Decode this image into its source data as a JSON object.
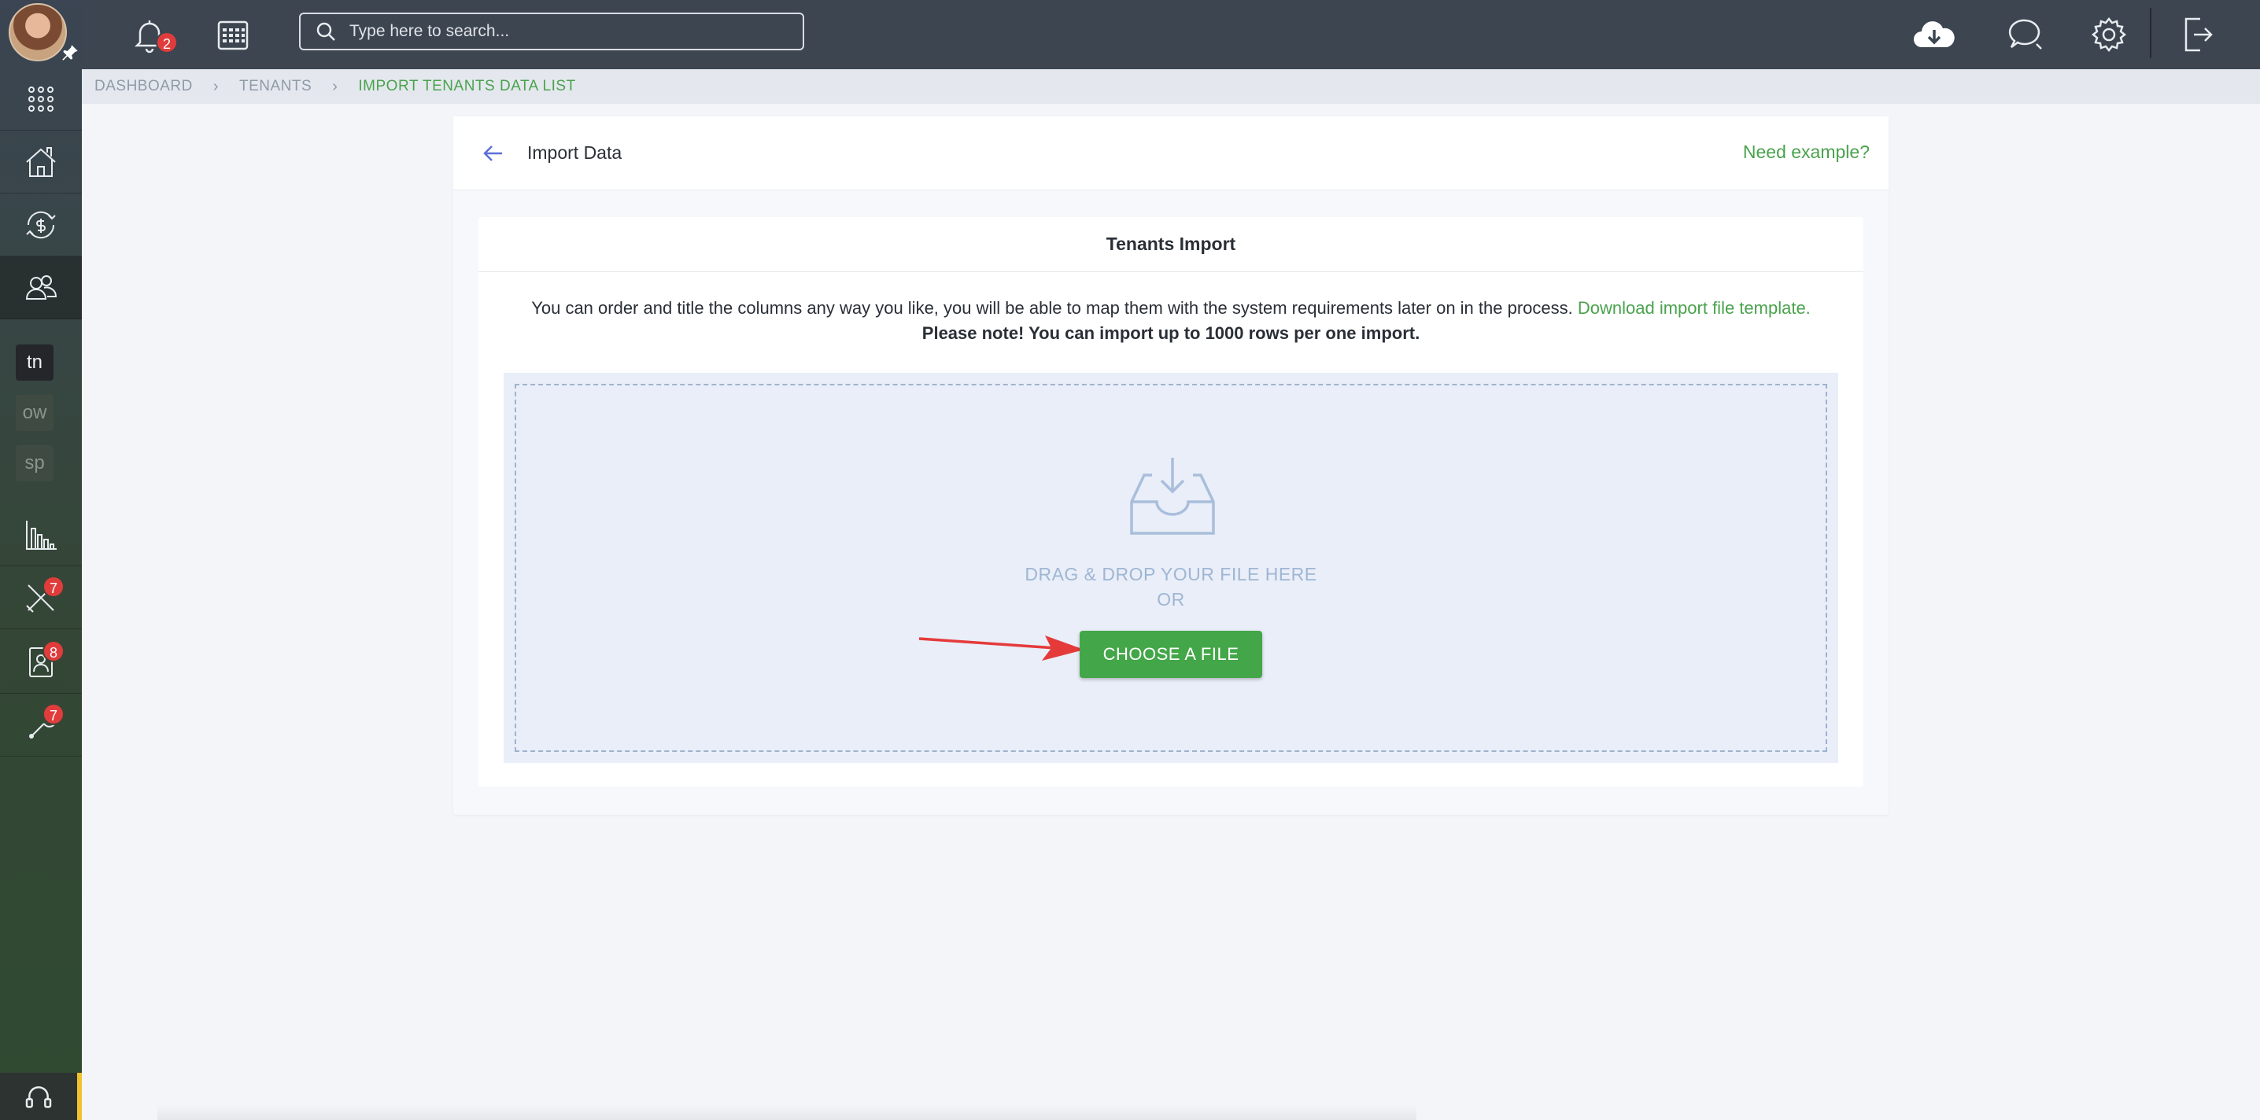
{
  "topbar": {
    "notification_count": "2",
    "search_placeholder": "Type here to search..."
  },
  "sidebar": {
    "chips": [
      "tn",
      "ow",
      "sp"
    ],
    "badges": {
      "maintenance": "7",
      "contacts": "8",
      "tools": "7"
    }
  },
  "breadcrumb": {
    "items": [
      "DASHBOARD",
      "TENANTS",
      "IMPORT TENANTS DATA LIST"
    ]
  },
  "card": {
    "title": "Import Data",
    "need_example": "Need example?"
  },
  "panel": {
    "title": "Tenants Import",
    "info_text": "You can order and title the columns any way you like, you will be able to map them with the system requirements later on in the process.",
    "download_link": "Download import file template.",
    "note": "Please note! You can import up to 1000 rows per one import.",
    "drag_text": "DRAG & DROP YOUR FILE HERE",
    "or_text": "OR",
    "choose_button": "CHOOSE A FILE"
  },
  "colors": {
    "accent_green": "#43a648",
    "topbar": "#3c4550",
    "annotation_arrow": "#e53a3a"
  }
}
